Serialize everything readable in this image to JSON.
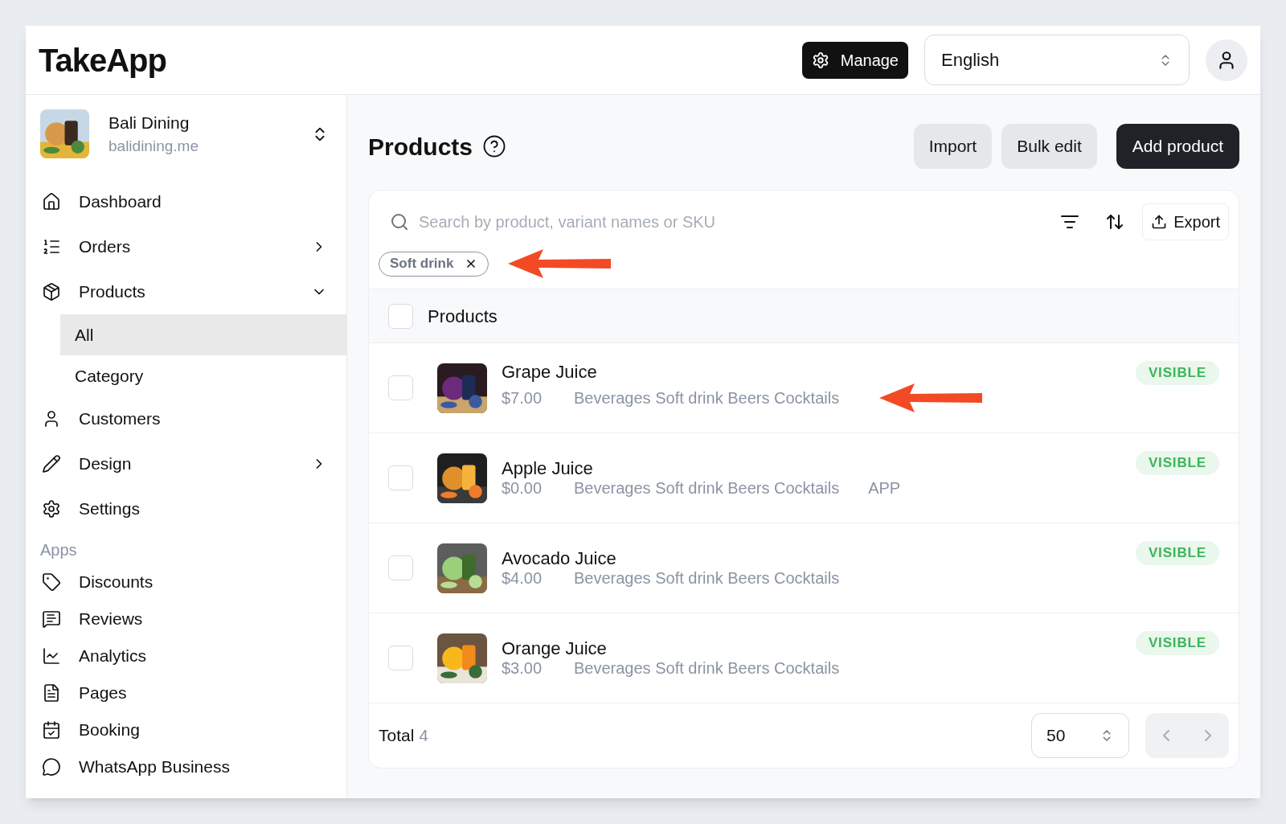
{
  "header": {
    "logo": "TakeApp",
    "manage_button": "Manage",
    "language": "English"
  },
  "store": {
    "name": "Bali Dining",
    "domain": "balidining.me"
  },
  "nav": [
    {
      "label": "Dashboard",
      "kind": "link"
    },
    {
      "label": "Orders",
      "kind": "group",
      "expanded": false
    },
    {
      "label": "Products",
      "kind": "group",
      "expanded": true,
      "children": [
        {
          "label": "All",
          "selected": true
        },
        {
          "label": "Category",
          "selected": false
        }
      ]
    },
    {
      "label": "Customers",
      "kind": "link"
    },
    {
      "label": "Design",
      "kind": "group",
      "expanded": false
    },
    {
      "label": "Settings",
      "kind": "link"
    }
  ],
  "apps": {
    "heading": "Apps",
    "items": [
      "Discounts",
      "Reviews",
      "Analytics",
      "Pages",
      "Booking",
      "WhatsApp Business"
    ]
  },
  "page": {
    "title": "Products",
    "buttons": [
      "Import",
      "Bulk edit"
    ],
    "primary_button": "Add product"
  },
  "search": {
    "placeholder": "Search by product, variant names or SKU"
  },
  "export_button": "Export",
  "filters": [
    "Soft drink"
  ],
  "table": {
    "header": {
      "label": "Products",
      "checked": false
    },
    "rows": [
      {
        "name": "Grape Juice",
        "price": "$7.00",
        "categories": "Beverages Soft drink Beers Cocktails",
        "checked": false,
        "status": "VISIBLE",
        "annotated": true
      },
      {
        "name": "Apple Juice",
        "price": "$0.00",
        "categories": "Beverages Soft drink Beers Cocktails",
        "extra": "APP",
        "checked": false,
        "status": "VISIBLE",
        "annotated": false
      },
      {
        "name": "Avocado Juice",
        "price": "$4.00",
        "categories": "Beverages Soft drink Beers Cocktails",
        "checked": false,
        "status": "VISIBLE",
        "annotated": false
      },
      {
        "name": "Orange Juice",
        "price": "$3.00",
        "categories": "Beverages Soft drink Beers Cocktails",
        "checked": false,
        "status": "VISIBLE",
        "annotated": false
      }
    ]
  },
  "footer": {
    "total_label": "Total",
    "total": "4",
    "page_size": "50"
  }
}
